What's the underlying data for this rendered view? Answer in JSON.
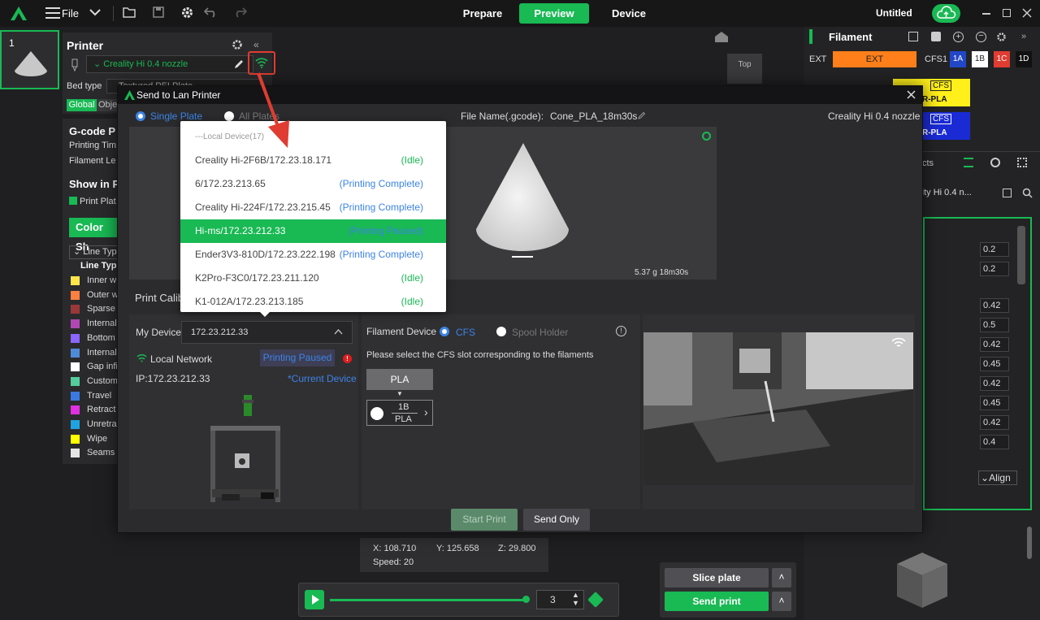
{
  "topbar": {
    "file": "File",
    "tabs": [
      "Prepare",
      "Preview",
      "Device"
    ],
    "project": "Untitled"
  },
  "plate": {
    "number": "1"
  },
  "printer": {
    "title": "Printer",
    "preset": "Creality Hi 0.4 nozzle",
    "bed_type_label": "Bed type",
    "bed_value": "Textured PEI Plate",
    "tab_global": "Global",
    "tab_objects": "Obje"
  },
  "gcode": {
    "title": "G-code P",
    "printing_time": "Printing Tim",
    "filament_len": "Filament Le",
    "show_in": "Show in P",
    "print_plate": "Print Plat",
    "color_scheme": "Color Sh",
    "line_type_select": "Line Typ",
    "line_type_header": "Line Typ",
    "items": [
      {
        "label": "Inner w",
        "color": "#ffe54c"
      },
      {
        "label": "Outer w",
        "color": "#ff8040"
      },
      {
        "label": "Sparse",
        "color": "#9a3838"
      },
      {
        "label": "Internal",
        "color": "#b047b2"
      },
      {
        "label": "Bottom",
        "color": "#8c66ff"
      },
      {
        "label": "Internal",
        "color": "#4f8ad6"
      },
      {
        "label": "Gap infi",
        "color": "#ffffff"
      },
      {
        "label": "Custom",
        "color": "#54cc9c"
      },
      {
        "label": "Travel",
        "color": "#3a7ae0"
      },
      {
        "label": "Retract",
        "color": "#e030e0"
      },
      {
        "label": "Unretra",
        "color": "#1fa3e0"
      },
      {
        "label": "Wipe",
        "color": "#ffff00"
      },
      {
        "label": "Seams",
        "color": "#e5e5e5"
      }
    ]
  },
  "filament_panel": {
    "title": "Filament",
    "ext_label": "EXT",
    "ext_slot": "EXT",
    "cfs_label": "CFS1",
    "slots": [
      "1A",
      "1B",
      "1C",
      "1D"
    ],
    "chip1": "CFS",
    "chip1_sub": "R-PLA",
    "chip2": "CFS",
    "chip2_sub": "R-PLA",
    "objects_tab": "cts",
    "preset": "eality Hi 0.4 n...",
    "values": [
      "0.2",
      "0.2",
      "0.42",
      "0.5",
      "0.42",
      "0.45",
      "0.42",
      "0.45",
      "0.42",
      "0.4"
    ],
    "align": "Align"
  },
  "view": {
    "top_label": "Top"
  },
  "dialog": {
    "title": "Send to Lan Printer",
    "single_plate": "Single Plate",
    "all_plates": "All Plates",
    "file_name_label": "File Name(.gcode):",
    "file_name": "Cone_PLA_18m30s",
    "printer_preset": "Creality Hi 0.4 nozzle",
    "stats": "5.37 g  18m30s",
    "calib_label": "Print Calib",
    "my_device_label": "My Device",
    "my_device_value": "172.23.212.33",
    "network": "Local Network",
    "status_badge": "Printing Paused",
    "ip": "IP:172.23.212.33",
    "current_device": "*Current Device",
    "filament_device_label": "Filament Device",
    "cfs_option": "CFS",
    "spool_option": "Spool Holder",
    "cfs_instruction": "Please select the CFS slot corresponding to the filaments",
    "pla_button": "PLA",
    "slot_top": "1B",
    "slot_bottom": "PLA",
    "start_print": "Start Print",
    "send_only": "Send Only"
  },
  "dropdown": {
    "header": "---Local Device(17)",
    "devices": [
      {
        "name": "Creality Hi-2F6B/172.23.18.171",
        "status": "(Idle)",
        "status_color": "#19b954"
      },
      {
        "name": "6/172.23.213.65",
        "status": "(Printing Complete)",
        "status_color": "#3c84e6"
      },
      {
        "name": "Creality Hi-224F/172.23.215.45",
        "status": "(Printing Complete)",
        "status_color": "#3c84e6"
      },
      {
        "name": "Hi-ms/172.23.212.33",
        "status": "(Printing Paused)",
        "status_color": "#3c84e6"
      },
      {
        "name": "Ender3V3-810D/172.23.222.198",
        "status": "(Printing Complete)",
        "status_color": "#3c84e6"
      },
      {
        "name": "K2Pro-F3C0/172.23.211.120",
        "status": "(Idle)",
        "status_color": "#19b954"
      },
      {
        "name": "K1-012A/172.23.213.185",
        "status": "(Idle)",
        "status_color": "#19b954"
      }
    ],
    "selected_index": 3
  },
  "coords": {
    "x": "X: 108.710",
    "y": "Y: 125.658",
    "z": "Z: 29.800",
    "speed": "Speed: 20"
  },
  "playback": {
    "layer": "3",
    "progress": 0.98
  },
  "slice": {
    "slice_plate": "Slice plate",
    "send_print": "Send print"
  },
  "colors": {
    "accent": "#19b954",
    "orange": "#ff7f1a",
    "highlight": "#e03c31"
  }
}
